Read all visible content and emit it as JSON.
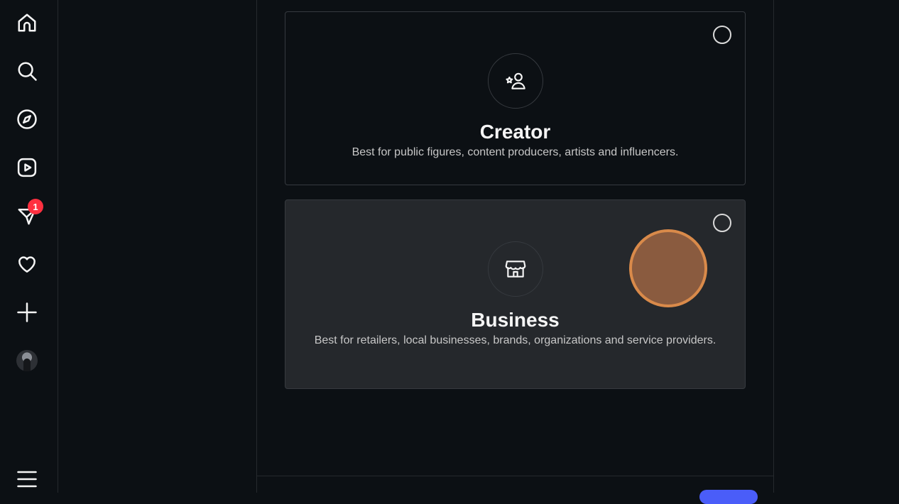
{
  "sidebar": {
    "items": [
      {
        "name": "home",
        "icon": "home-icon"
      },
      {
        "name": "search",
        "icon": "search-icon"
      },
      {
        "name": "explore",
        "icon": "compass-icon"
      },
      {
        "name": "reels",
        "icon": "reels-icon"
      },
      {
        "name": "messages",
        "icon": "messenger-icon",
        "badge": "1"
      },
      {
        "name": "notifications",
        "icon": "heart-icon"
      },
      {
        "name": "create",
        "icon": "plus-icon"
      },
      {
        "name": "profile",
        "icon": "avatar"
      }
    ],
    "more_icon": "menu-icon"
  },
  "account_types": [
    {
      "title": "Creator",
      "description": "Best for public figures, content producers, artists and influencers.",
      "icon": "creator-star-person-icon",
      "selected": false
    },
    {
      "title": "Business",
      "description": "Best for retailers, local businesses, brands, organizations and service providers.",
      "icon": "storefront-icon",
      "selected": false
    }
  ],
  "colors": {
    "background": "#0c1014",
    "card_hover": "#25282c",
    "badge": "#ff3040",
    "cursor_fill": "#8a5b3f",
    "cursor_ring": "#d98a4a",
    "primary_button": "#4a5df9"
  }
}
